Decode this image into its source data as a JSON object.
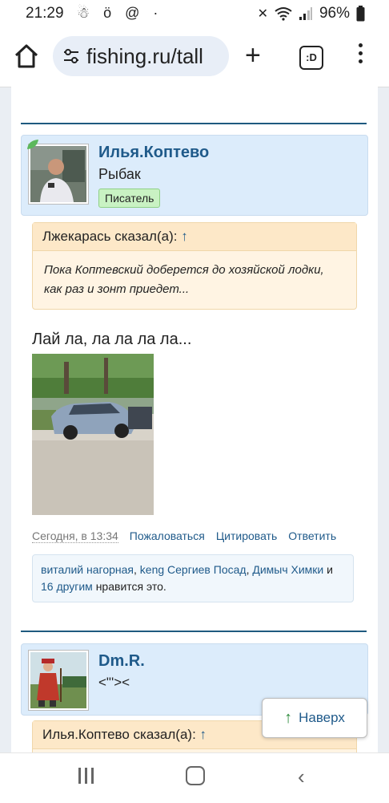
{
  "status": {
    "time": "21:29",
    "battery": "96%"
  },
  "browser": {
    "url": "fishing.ru/tall",
    "tabs_label": ":D"
  },
  "post1": {
    "username": "Илья.Коптево",
    "title": "Рыбак",
    "badge": "Писатель",
    "quote_author": "Лжекарась сказал(а):",
    "quote_arrow": "↑",
    "quote_text": "Пока Коптевский доберется до хозяйской лодки, как раз и зонт приедет...",
    "message": "Лай ла, ла ла ла ла...",
    "date": "Сегодня, в 13:34",
    "actions": [
      "Пожаловаться",
      "Цитировать",
      "Ответить"
    ],
    "likes": {
      "user1": "виталий нагорная",
      "user2": "keng Сергиев Посад",
      "user3": "Димыч Химки",
      "conj": "и",
      "others": "16 другим",
      "suffix": "нравится это."
    }
  },
  "post2": {
    "username": "Dm.R.",
    "title": "<\"'><",
    "quote_author": "Илья.Коптево сказал(а):",
    "quote_arrow": "↑"
  },
  "to_top": {
    "arrow": "↑",
    "label": "Наверх"
  }
}
